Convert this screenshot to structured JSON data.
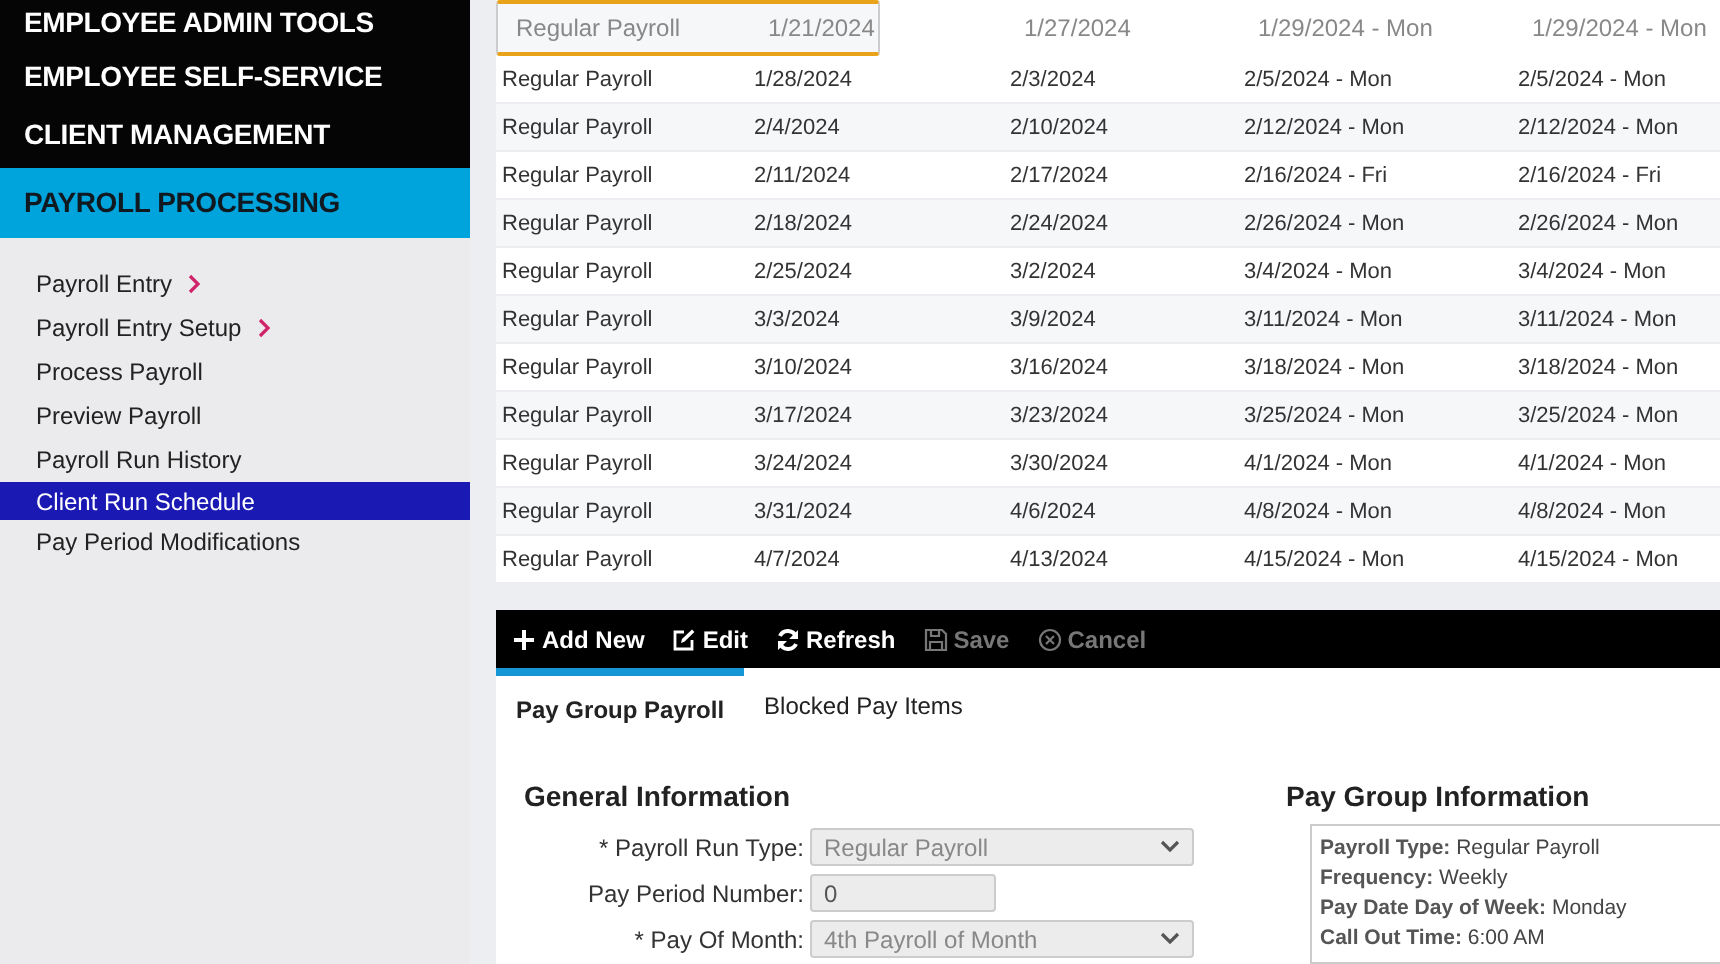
{
  "sidebar": {
    "sections": [
      {
        "label": "EMPLOYEE ADMIN TOOLS",
        "selected": false
      },
      {
        "label": "EMPLOYEE SELF-SERVICE",
        "selected": false
      },
      {
        "label": "CLIENT MANAGEMENT",
        "selected": false
      },
      {
        "label": "PAYROLL PROCESSING",
        "selected": true
      }
    ],
    "items": [
      {
        "label": "Payroll Entry",
        "has_submenu": true,
        "selected": false
      },
      {
        "label": "Payroll Entry Setup",
        "has_submenu": true,
        "selected": false
      },
      {
        "label": "Process Payroll",
        "has_submenu": false,
        "selected": false
      },
      {
        "label": "Preview Payroll",
        "has_submenu": false,
        "selected": false
      },
      {
        "label": "Payroll Run History",
        "has_submenu": false,
        "selected": false
      },
      {
        "label": "Client Run Schedule",
        "has_submenu": false,
        "selected": true
      },
      {
        "label": "Pay Period Modifications",
        "has_submenu": false,
        "selected": false
      }
    ]
  },
  "table": {
    "rows": [
      {
        "selected": true,
        "cells": [
          "Regular Payroll",
          "1/21/2024",
          "1/27/2024",
          "1/29/2024 - Mon",
          "1/29/2024 - Mon"
        ]
      },
      {
        "selected": false,
        "cells": [
          "Regular Payroll",
          "1/28/2024",
          "2/3/2024",
          "2/5/2024 - Mon",
          "2/5/2024 - Mon"
        ]
      },
      {
        "selected": false,
        "cells": [
          "Regular Payroll",
          "2/4/2024",
          "2/10/2024",
          "2/12/2024 - Mon",
          "2/12/2024 - Mon"
        ]
      },
      {
        "selected": false,
        "cells": [
          "Regular Payroll",
          "2/11/2024",
          "2/17/2024",
          "2/16/2024 - Fri",
          "2/16/2024 - Fri"
        ]
      },
      {
        "selected": false,
        "cells": [
          "Regular Payroll",
          "2/18/2024",
          "2/24/2024",
          "2/26/2024 - Mon",
          "2/26/2024 - Mon"
        ]
      },
      {
        "selected": false,
        "cells": [
          "Regular Payroll",
          "2/25/2024",
          "3/2/2024",
          "3/4/2024 - Mon",
          "3/4/2024 - Mon"
        ]
      },
      {
        "selected": false,
        "cells": [
          "Regular Payroll",
          "3/3/2024",
          "3/9/2024",
          "3/11/2024 - Mon",
          "3/11/2024 - Mon"
        ]
      },
      {
        "selected": false,
        "cells": [
          "Regular Payroll",
          "3/10/2024",
          "3/16/2024",
          "3/18/2024 - Mon",
          "3/18/2024 - Mon"
        ]
      },
      {
        "selected": false,
        "cells": [
          "Regular Payroll",
          "3/17/2024",
          "3/23/2024",
          "3/25/2024 - Mon",
          "3/25/2024 - Mon"
        ]
      },
      {
        "selected": false,
        "cells": [
          "Regular Payroll",
          "3/24/2024",
          "3/30/2024",
          "4/1/2024 - Mon",
          "4/1/2024 - Mon"
        ]
      },
      {
        "selected": false,
        "cells": [
          "Regular Payroll",
          "3/31/2024",
          "4/6/2024",
          "4/8/2024 - Mon",
          "4/8/2024 - Mon"
        ]
      },
      {
        "selected": false,
        "cells": [
          "Regular Payroll",
          "4/7/2024",
          "4/13/2024",
          "4/15/2024 - Mon",
          "4/15/2024 - Mon"
        ]
      }
    ]
  },
  "toolbar": [
    {
      "kind": "add",
      "label": "Add New",
      "disabled": false
    },
    {
      "kind": "edit",
      "label": "Edit",
      "disabled": false
    },
    {
      "kind": "refresh",
      "label": "Refresh",
      "disabled": false
    },
    {
      "kind": "save",
      "label": "Save",
      "disabled": true
    },
    {
      "kind": "cancel",
      "label": "Cancel",
      "disabled": true
    }
  ],
  "tabs": [
    {
      "label": "Pay Group Payroll",
      "selected": true
    },
    {
      "label": "Blocked Pay Items",
      "selected": false
    }
  ],
  "general": {
    "title": "General Information",
    "fields": [
      {
        "kind": "select",
        "label": "* Payroll Run Type:",
        "value": "Regular Payroll"
      },
      {
        "kind": "input",
        "label": "Pay Period Number:",
        "value": "0"
      },
      {
        "kind": "select",
        "label": "* Pay Of Month:",
        "value": "4th Payroll of Month"
      }
    ]
  },
  "pay_group": {
    "title": "Pay Group Information",
    "lines": [
      {
        "label": "Payroll Type:",
        "value": "Regular Payroll"
      },
      {
        "label": "Frequency:",
        "value": "Weekly"
      },
      {
        "label": "Pay Date Day of Week:",
        "value": "Monday"
      },
      {
        "label": "Call Out Time:",
        "value": "6:00 AM"
      }
    ]
  }
}
